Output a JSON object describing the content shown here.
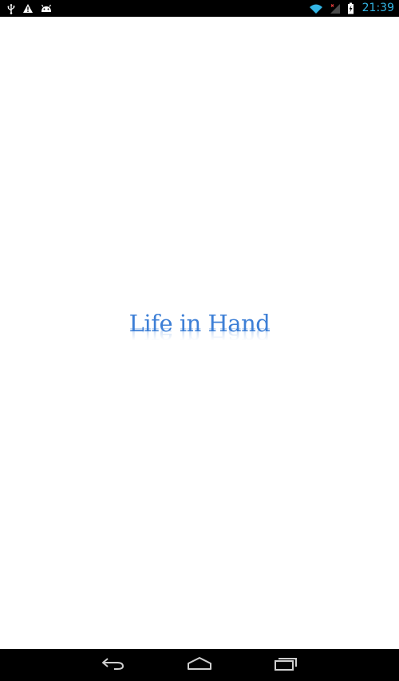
{
  "status_bar": {
    "left_icons": [
      "usb-icon",
      "warning-icon",
      "android-icon"
    ],
    "right_icons": [
      "wifi-icon",
      "signal-icon",
      "battery-charging-icon"
    ],
    "time": "21:39",
    "time_color": "#33b5e5"
  },
  "splash": {
    "title": "Life in Hand",
    "title_color": "#3d7fd6"
  },
  "nav_bar": {
    "buttons": [
      "back-icon",
      "home-icon",
      "recent-apps-icon"
    ]
  }
}
